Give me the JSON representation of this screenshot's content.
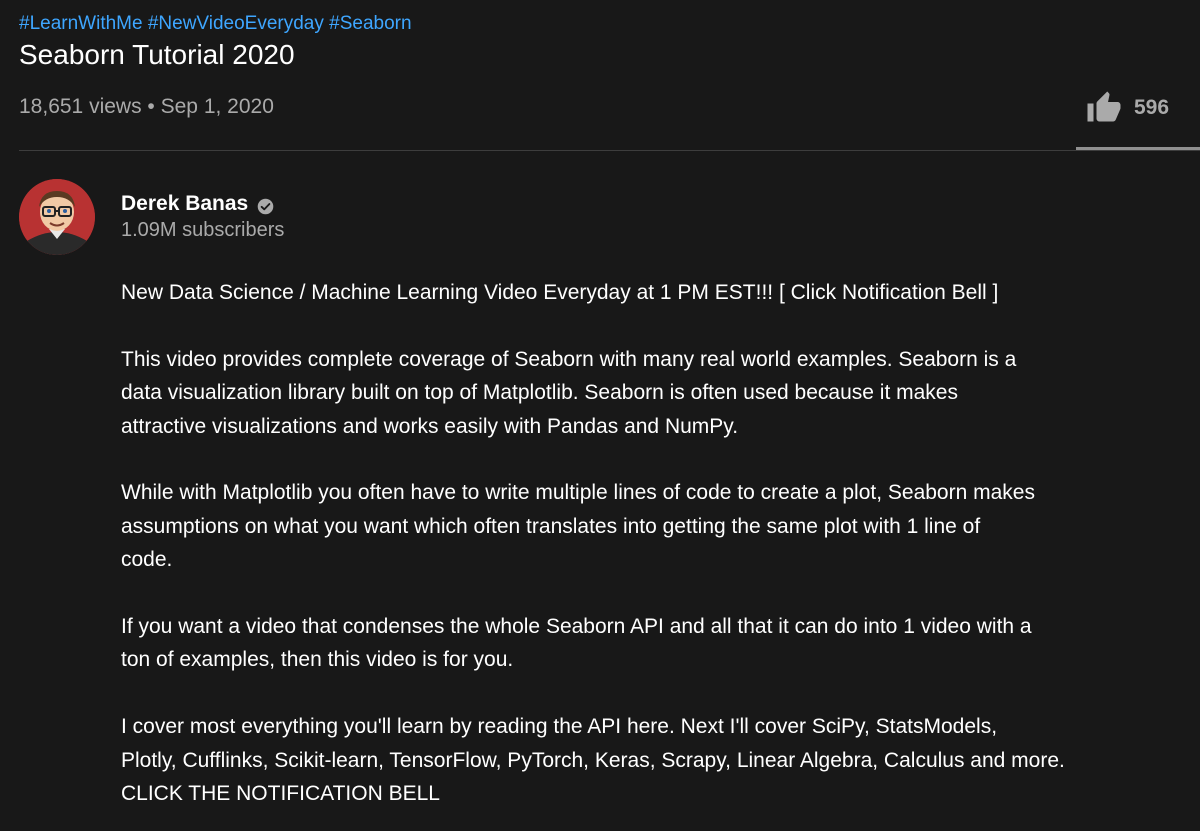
{
  "hashtags": [
    "#LearnWithMe",
    "#NewVideoEveryday",
    "#Seaborn"
  ],
  "video": {
    "title": "Seaborn Tutorial 2020",
    "views": "18,651 views",
    "separator": "•",
    "date": "Sep 1, 2020",
    "likes": "596"
  },
  "channel": {
    "name": "Derek Banas",
    "subscribers": "1.09M subscribers",
    "verified": true
  },
  "description": {
    "paragraphs": [
      [
        "New Data Science / Machine Learning Video Everyday at 1 PM EST!!! [ Click Notification Bell ]"
      ],
      [
        "This video provides complete coverage of Seaborn with many real world examples. Seaborn is a",
        "data visualization library built on top of Matplotlib. Seaborn is often used because it makes",
        "attractive visualizations and works easily with Pandas and NumPy."
      ],
      [
        "While with Matplotlib you often have to write multiple lines of code to create a plot, Seaborn makes",
        "assumptions on what you want which often translates into getting the same plot with 1 line of",
        "code."
      ],
      [
        "If you want a video that condenses the whole Seaborn API and all that it can do into 1 video with a",
        "ton of examples, then this video is for you."
      ],
      [
        "I cover most everything you'll learn by reading the API here. Next I'll cover SciPy, StatsModels,",
        "Plotly, Cufflinks, Scikit-learn, TensorFlow, PyTorch, Keras, Scrapy, Linear Algebra, Calculus and more.",
        "CLICK THE NOTIFICATION BELL"
      ]
    ]
  },
  "icons": {
    "like": "thumbs-up-icon",
    "verified": "verified-check-icon",
    "avatar": "channel-avatar"
  },
  "colors": {
    "background": "#181818",
    "hashtag": "#3ea6ff",
    "primary_text": "#ffffff",
    "secondary_text": "#aaaaaa",
    "divider": "#3d3d3d"
  }
}
